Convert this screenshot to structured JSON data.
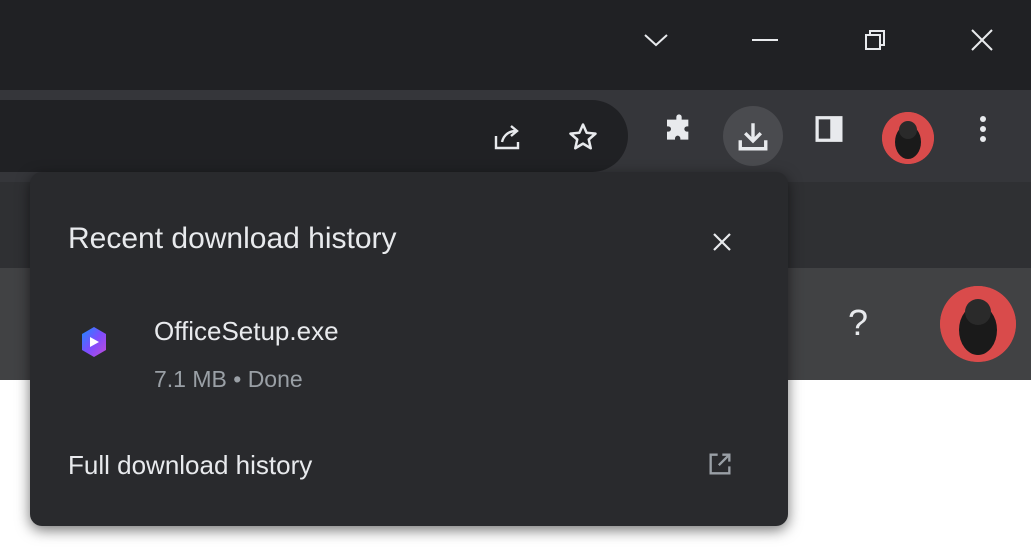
{
  "popup": {
    "title": "Recent download history",
    "close_icon": "close-icon",
    "items": [
      {
        "name": "OfficeSetup.exe",
        "status": "7.1 MB • Done",
        "icon": "office-logo-icon"
      }
    ],
    "full_history_label": "Full download history",
    "full_history_icon": "open-in-new-icon"
  },
  "page": {
    "help_glyph": "?"
  },
  "colors": {
    "titlebar": "#202124",
    "toolbar": "#35363a",
    "popup_bg": "#292a2d",
    "text_primary": "#e8eaed",
    "text_secondary": "#9aa0a6",
    "avatar": "#d94b4b"
  }
}
